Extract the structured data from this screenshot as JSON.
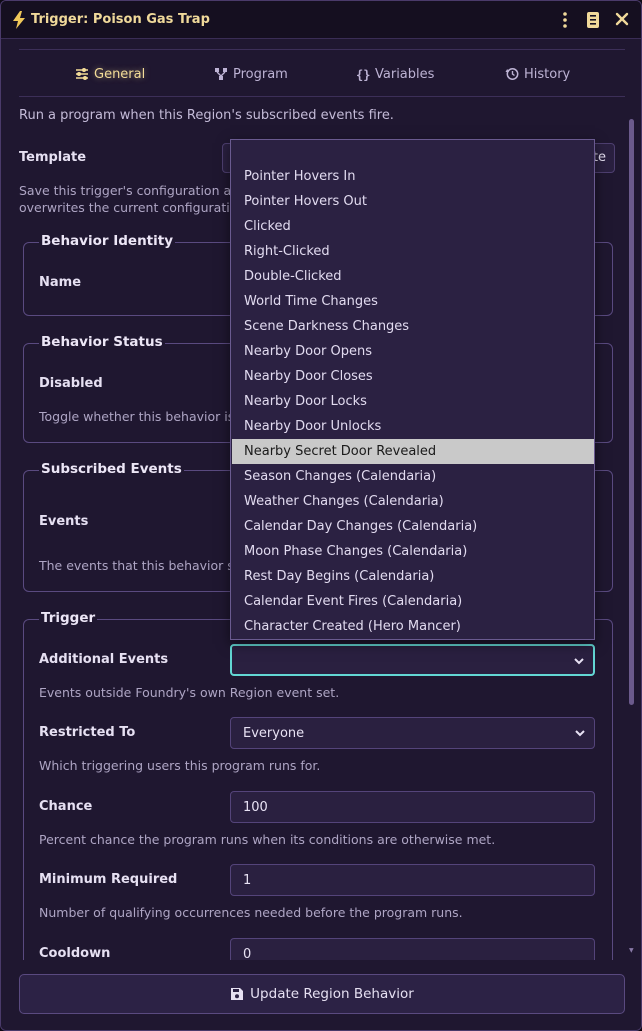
{
  "window": {
    "title": "Trigger: Poison Gas Trap"
  },
  "tabs": [
    {
      "label": "General",
      "icon": "sliders-icon",
      "active": true
    },
    {
      "label": "Program",
      "icon": "nodes-icon"
    },
    {
      "label": "Variables",
      "icon": "braces-icon"
    },
    {
      "label": "History",
      "icon": "history-icon"
    }
  ],
  "intro": "Run a program when this Region's subscribed events fire.",
  "template": {
    "label": "Template",
    "button_partial": "te",
    "hint_partial": "Save this trigger's configuration and",
    "hint_partial2": "overwrites the current configuration"
  },
  "behavior_identity": {
    "legend": "Behavior Identity",
    "name_label": "Name"
  },
  "behavior_status": {
    "legend": "Behavior Status",
    "disabled_label": "Disabled",
    "hint": "Toggle whether this behavior is t"
  },
  "subscribed_events": {
    "legend": "Subscribed Events",
    "events_label": "Events",
    "hint": "The events that this behavior sub"
  },
  "trigger": {
    "legend": "Trigger",
    "additional_events": {
      "label": "Additional Events",
      "value": "",
      "hint": "Events outside Foundry's own Region event set."
    },
    "restricted_to": {
      "label": "Restricted To",
      "value": "Everyone",
      "hint": "Which triggering users this program runs for."
    },
    "chance": {
      "label": "Chance",
      "value": "100",
      "hint": "Percent chance the program runs when its conditions are otherwise met."
    },
    "minimum_required": {
      "label": "Minimum Required",
      "value": "1",
      "hint": "Number of qualifying occurrences needed before the program runs."
    },
    "cooldown": {
      "label": "Cooldown",
      "value": "0"
    }
  },
  "dropdown": {
    "options": [
      "Pointer Hovers In",
      "Pointer Hovers Out",
      "Clicked",
      "Right-Clicked",
      "Double-Clicked",
      "World Time Changes",
      "Scene Darkness Changes",
      "Nearby Door Opens",
      "Nearby Door Closes",
      "Nearby Door Locks",
      "Nearby Door Unlocks",
      "Nearby Secret Door Revealed",
      "Season Changes (Calendaria)",
      "Weather Changes (Calendaria)",
      "Calendar Day Changes (Calendaria)",
      "Moon Phase Changes (Calendaria)",
      "Rest Day Begins (Calendaria)",
      "Calendar Event Fires (Calendaria)",
      "Character Created (Hero Mancer)"
    ],
    "highlighted": "Nearby Secret Door Revealed"
  },
  "footer": {
    "submit_label": "Update Region Behavior"
  },
  "colors": {
    "accent": "#f3dc98",
    "focus": "#63d7d4",
    "background": "#1f1730",
    "highlight": "#c9c9c9"
  }
}
